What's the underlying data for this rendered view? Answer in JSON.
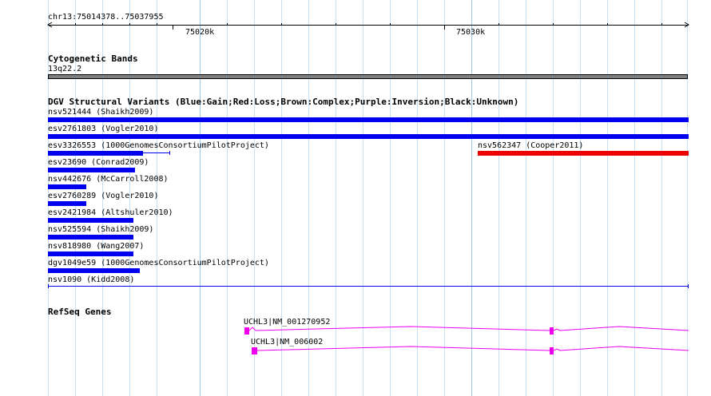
{
  "ruler": {
    "range_label": "chr13:75014378..75037955",
    "major_labels": [
      "75020k",
      "75030k"
    ]
  },
  "cytoband": {
    "title": "Cytogenetic Bands",
    "band_label": "13q22.2",
    "band_color": "#808080"
  },
  "dgv": {
    "title": "DGV Structural Variants (Blue:Gain;Red:Loss;Brown:Complex;Purple:Inversion;Black:Unknown)",
    "gain_color": "#0000ee",
    "loss_color": "#ee0000",
    "variants": [
      {
        "label": "nsv521444 (Shaikh2009)",
        "type": "gain"
      },
      {
        "label": "esv2761803 (Vogler2010)",
        "type": "gain"
      },
      {
        "label": "esv3326553 (1000GenomesConsortiumPilotProject)",
        "type": "gain"
      },
      {
        "label": "nsv562347 (Cooper2011)",
        "type": "loss"
      },
      {
        "label": "esv23690 (Conrad2009)",
        "type": "gain"
      },
      {
        "label": "nsv442676 (McCarroll2008)",
        "type": "gain"
      },
      {
        "label": "esv2760289 (Vogler2010)",
        "type": "gain"
      },
      {
        "label": "esv2421984 (Altshuler2010)",
        "type": "gain"
      },
      {
        "label": "nsv525594 (Shaikh2009)",
        "type": "gain"
      },
      {
        "label": "nsv818980 (Wang2007)",
        "type": "gain"
      },
      {
        "label": "dgv1049e59 (1000GenomesConsortiumPilotProject)",
        "type": "gain"
      },
      {
        "label": "nsv1090 (Kidd2008)",
        "type": "gain"
      }
    ]
  },
  "refseq": {
    "title": "RefSeq Genes",
    "gene_color": "#ee00ee",
    "transcripts": [
      {
        "label": "UCHL3|NM_001270952"
      },
      {
        "label": "UCHL3|NM_006002"
      }
    ]
  }
}
